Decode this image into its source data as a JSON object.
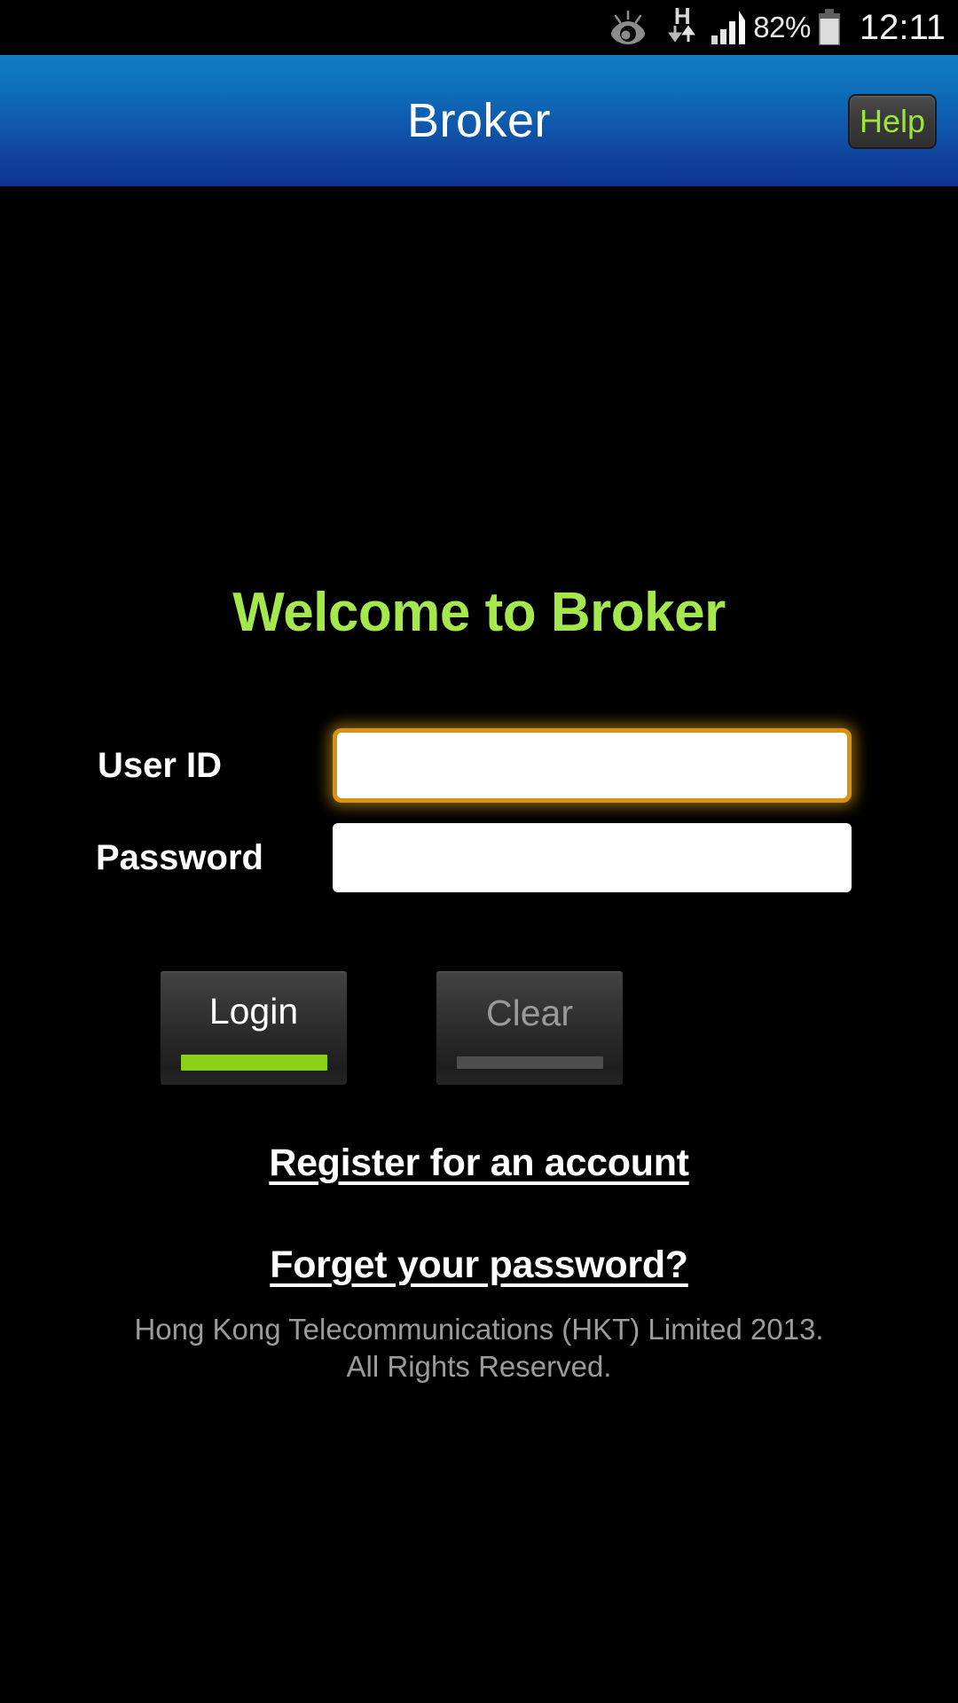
{
  "status_bar": {
    "smart_stay_icon": "eye-icon",
    "network_type": "H",
    "data_transfer_icon": "data-transfer-arrows-icon",
    "signal_icon": "signal-bars-icon",
    "battery_percent": "82%",
    "battery_icon": "battery-icon",
    "clock": "12:11"
  },
  "header": {
    "title": "Broker",
    "help_label": "Help",
    "gradient_top": "#0f7cc4",
    "gradient_bottom": "#0d3590",
    "help_text_color": "#9ce53a"
  },
  "main": {
    "welcome_title": "Welcome to Broker",
    "welcome_color": "#a5e84b",
    "form": {
      "userid": {
        "label": "User ID",
        "value": "",
        "placeholder": "",
        "focused": true,
        "focus_border_color": "#d9920f"
      },
      "password": {
        "label": "Password",
        "value": "",
        "placeholder": "",
        "focused": false
      }
    },
    "buttons": {
      "login": {
        "label": "Login",
        "underline_color": "#8bd216",
        "selected": true
      },
      "clear": {
        "label": "Clear",
        "underline_color": "#4e4e4e",
        "selected": false
      }
    },
    "links": {
      "register": "Register for an account",
      "forgot": "Forget your password?"
    }
  },
  "footer": {
    "line1": "Hong Kong Telecommunications (HKT) Limited 2013.",
    "line2": "All Rights Reserved.",
    "color": "#9b9b9b"
  }
}
